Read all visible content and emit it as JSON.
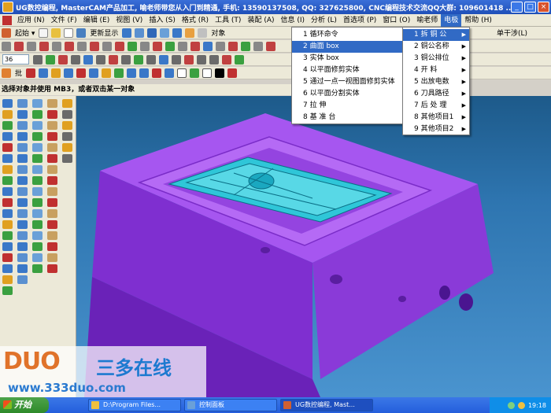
{
  "window": {
    "title": "UG数控编程, MasterCAM产品加工, 喻老师带您从入门到精通, 手机: 13590137508, QQ: 327625800, CNC编程技术交流QQ大群: 109601418 ..."
  },
  "menubar": {
    "items": [
      "应用 (N)",
      "文件 (F)",
      "编辑 (E)",
      "视图 (V)",
      "插入 (S)",
      "格式 (R)",
      "工具 (T)",
      "装配 (A)",
      "信息 (I)",
      "分析 (L)",
      "首选项 (P)",
      "窗口 (O)",
      "喻老师",
      "电极",
      "帮助 (H)"
    ],
    "active": "电极"
  },
  "toolbar1": {
    "start_label": "起始 ▾",
    "update_label": "更新显示",
    "object_label": "对象",
    "single_label": "单干涉(L)"
  },
  "toolbar3": {
    "select_value": "36"
  },
  "toolbar4": {
    "batch_label": "批"
  },
  "statusline": {
    "text": "选择对象并使用 MB3，或者双击某一对象"
  },
  "dropdown_main": {
    "items": [
      {
        "num": "1",
        "label": "循环命令"
      },
      {
        "num": "2",
        "label": "曲面 box"
      },
      {
        "num": "3",
        "label": "实体 box"
      },
      {
        "num": "4",
        "label": "以平面修剪实体"
      },
      {
        "num": "5",
        "label": "通过一点一视图面修剪实体"
      },
      {
        "num": "6",
        "label": "以平面分割实体"
      },
      {
        "num": "7",
        "label": "拉  伸"
      },
      {
        "num": "8",
        "label": "基 准 台"
      }
    ],
    "selected_index": 1
  },
  "dropdown_sub": {
    "items": [
      {
        "num": "1",
        "label": "拆  铜  公"
      },
      {
        "num": "2",
        "label": "铜公名称"
      },
      {
        "num": "3",
        "label": "铜公排位"
      },
      {
        "num": "4",
        "label": "开    料"
      },
      {
        "num": "5",
        "label": "出放电数"
      },
      {
        "num": "6",
        "label": "刀具路径"
      },
      {
        "num": "7",
        "label": "后 处 理"
      },
      {
        "num": "8",
        "label": "其他项目1"
      },
      {
        "num": "9",
        "label": "其他项目2"
      }
    ],
    "selected_index": 0
  },
  "watermark": {
    "brand_a": "DUO",
    "brand_b": "三多在线",
    "url": "www.333duo.com"
  },
  "taskbar": {
    "start_label": "开始",
    "tasks": [
      "D:\\Program Files...",
      "控制面板",
      "UG数控编程, Mast..."
    ],
    "clock": "19:18"
  },
  "colors": {
    "model_purple": "#9a45e8",
    "part_cyan": "#2fc6d8",
    "viewport_top": "#1d5a8a",
    "menu_select": "#316ac5"
  }
}
